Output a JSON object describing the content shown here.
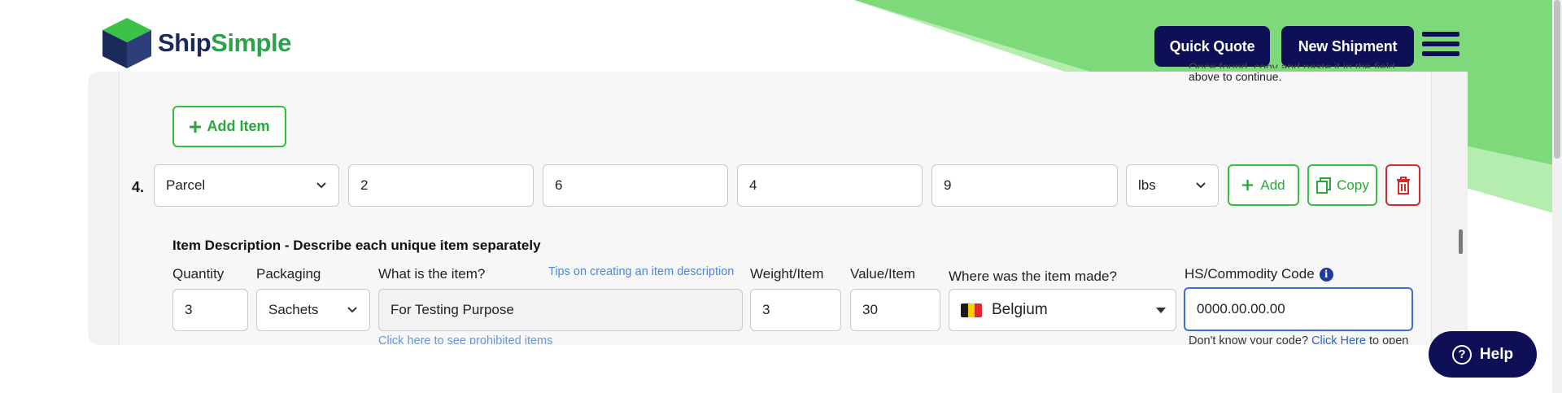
{
  "header": {
    "logo_part1": "Ship",
    "logo_part2": "Simple",
    "quick_quote": "Quick Quote",
    "new_shipment": "New Shipment"
  },
  "help_top": {
    "line1": "Once found, copy and paste it in the field",
    "line2": "above to continue."
  },
  "add_item_label": "Add Item",
  "package_row": {
    "number": "4.",
    "package_type": "Parcel",
    "length": "2",
    "width": "6",
    "height": "4",
    "weight": "9",
    "unit": "lbs",
    "add_label": "Add",
    "copy_label": "Copy"
  },
  "item_section": {
    "title": "Item Description - Describe each unique item separately",
    "labels": {
      "quantity": "Quantity",
      "packaging": "Packaging",
      "what": "What is the item?",
      "tips": "Tips on creating an item description",
      "weight": "Weight/Item",
      "value": "Value/Item",
      "origin": "Where was the item made?",
      "hs": "HS/Commodity Code"
    },
    "values": {
      "quantity": "3",
      "packaging": "Sachets",
      "what": "For Testing Purpose",
      "weight": "3",
      "value": "30",
      "origin": "Belgium",
      "hs": "0000.00.00.00"
    },
    "prohibited_link": "Click here to see prohibited items",
    "code_help_prefix": "Don't know your code?",
    "code_help_link": "Click Here",
    "code_help_suffix": "to open"
  },
  "help_button": "Help",
  "colors": {
    "navy": "#0f0f57",
    "green": "#33c13f",
    "red": "#d22b2b",
    "link_blue": "#4a86d9",
    "bg_green": "#7ed97a",
    "bg_green_light": "#b5edb0"
  }
}
